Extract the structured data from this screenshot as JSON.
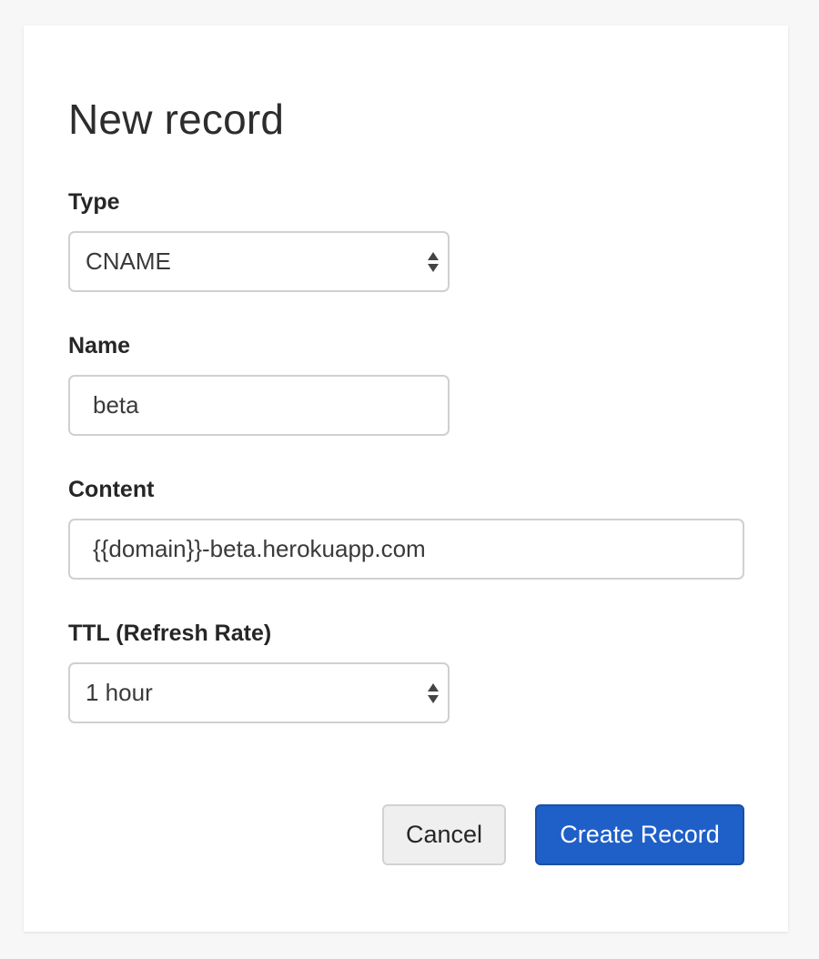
{
  "dialog": {
    "title": "New record"
  },
  "form": {
    "type": {
      "label": "Type",
      "value": "CNAME"
    },
    "name": {
      "label": "Name",
      "value": "beta"
    },
    "content": {
      "label": "Content",
      "value": "{{domain}}-beta.herokuapp.com"
    },
    "ttl": {
      "label": "TTL (Refresh Rate)",
      "value": "1 hour"
    }
  },
  "actions": {
    "cancel_label": "Cancel",
    "create_label": "Create Record"
  },
  "colors": {
    "primary": "#1f5fc8",
    "background": "#f7f7f7",
    "card": "#ffffff"
  }
}
